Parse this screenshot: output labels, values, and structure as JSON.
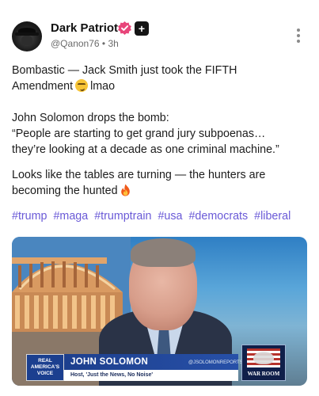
{
  "post": {
    "author_name": "Dark Patriot",
    "handle": "@Qanon76",
    "separator": "•",
    "time": "3h",
    "plus_badge": "+",
    "lines": [
      "Bombastic — Jack Smith just took the FIFTH",
      "Amendment",
      "lmao",
      "John Solomon drops the bomb:",
      "“People are starting to get grand jury subpoenas…",
      "they’re looking at a decade as one criminal machine.”",
      "Looks like the tables are turning — the hunters are",
      "becoming the hunted"
    ],
    "hashtags": [
      "#trump",
      "#maga",
      "#trumptrain",
      "#usa",
      "#democrats",
      "#liberal"
    ]
  },
  "media": {
    "network_logo_lines": [
      "REAL",
      "AMERICA'S",
      "VOICE"
    ],
    "lower_third_name": "JOHN SOLOMON",
    "lower_third_subtitle": "Host, 'Just the News, No Noise'",
    "lower_third_handle": "@JSOLOMONREPORTS",
    "show_logo": "WAR ROOM"
  },
  "icons": {
    "avatar": "masked-figure-avatar",
    "verified": "verified-badge-icon",
    "more": "vertical-ellipsis-icon",
    "emoji_1": "smirking-face-emoji",
    "emoji_2": "fire-emoji"
  },
  "colors": {
    "hashtag": "#6a5ad7",
    "verified_badge": "#e8457a",
    "lower_third_blue": "#1d3f8d"
  }
}
